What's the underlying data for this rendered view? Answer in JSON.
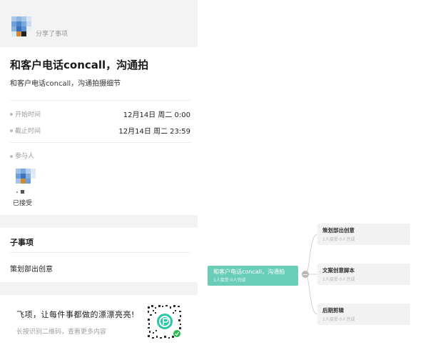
{
  "share": {
    "text": "分享了事项"
  },
  "task": {
    "title": "和客户电话concall，沟通拍",
    "description": "和客户电话concall，沟通拍摄细节",
    "start": {
      "label": "开始时间",
      "value": "12月14日 周二 0:00"
    },
    "end": {
      "label": "截止时间",
      "value": "12月14日 周二 23:59"
    },
    "participants_label": "参与人",
    "accepted_text": "已接受"
  },
  "subtasks": {
    "heading": "子事项",
    "items": [
      "策划部出创意"
    ]
  },
  "promo": {
    "title": "飞项，让每件事都做的漂漂亮亮!",
    "subtitle": "长按识别二维码，查看更多内容"
  },
  "mindmap": {
    "root": {
      "title": "和客户电话concall，沟通拍",
      "stats": "1人接受 0人完成"
    },
    "children": [
      {
        "title": "策划部出创意",
        "stats": "1人接受 0人完成"
      },
      {
        "title": "文案创意脚本",
        "stats": "1人接受 0人完成"
      },
      {
        "title": "后期剪辑",
        "stats": "1人接受 0人完成"
      }
    ]
  },
  "colors": {
    "accent": "#69cdb8",
    "muted": "#9a9a9a",
    "panel_gray": "#f3f3f3"
  }
}
